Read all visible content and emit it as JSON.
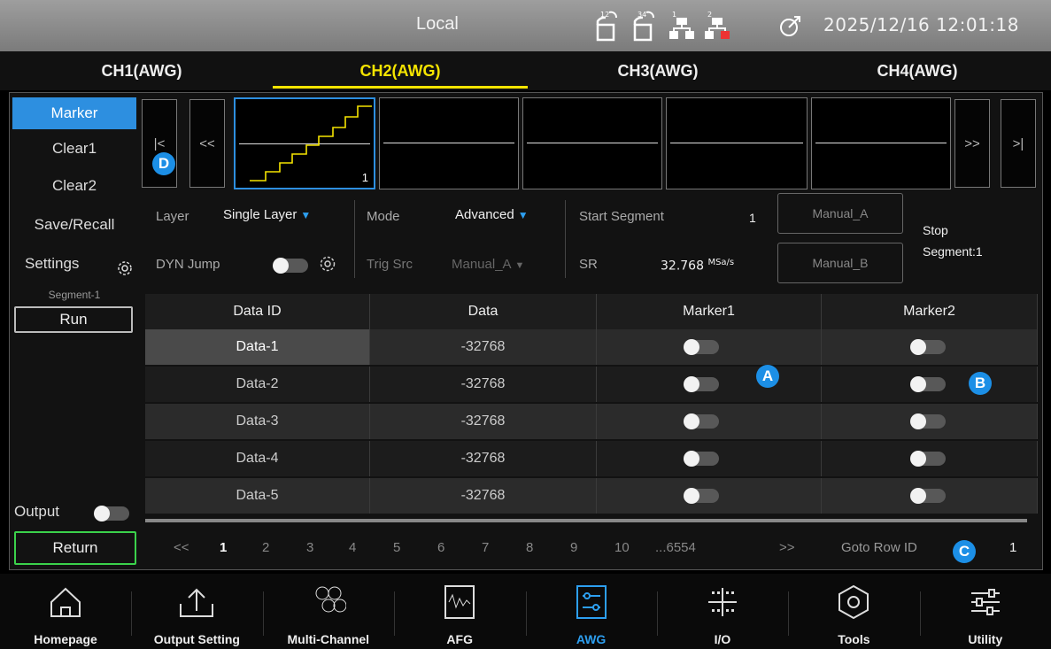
{
  "status": {
    "title": "Local",
    "datetime": "2025/12/16 12:01:18",
    "icons": [
      "usb-12-icon",
      "usb-34-icon",
      "network-1-icon",
      "network-2-disconnected-icon",
      "gps-icon"
    ],
    "icon_labels": [
      "12",
      "34",
      "1",
      "2"
    ]
  },
  "tabs": [
    "CH1(AWG)",
    "CH2(AWG)",
    "CH3(AWG)",
    "CH4(AWG)"
  ],
  "active_tab": "CH2(AWG)",
  "menu": {
    "marker": "Marker",
    "clear1": "Clear1",
    "clear2": "Clear2",
    "save_recall": "Save/Recall",
    "settings": "Settings",
    "segment": "Segment-1",
    "run": "Run",
    "output": "Output",
    "return": "Return"
  },
  "nav": {
    "first": "|<",
    "prev": "<<",
    "next": ">>",
    "last": ">|"
  },
  "thumb_index": "1",
  "controls": {
    "layer_label": "Layer",
    "layer_value": "Single Layer",
    "mode_label": "Mode",
    "mode_value": "Advanced",
    "start_segment_label": "Start Segment",
    "start_segment_value": "1",
    "manual_a": "Manual_A",
    "manual_b": "Manual_B",
    "stop_segment_line1": "Stop",
    "stop_segment_line2": "Segment:1",
    "dyn_jump_label": "DYN Jump",
    "trig_src_label": "Trig Src",
    "trig_src_value": "Manual_A",
    "sr_label": "SR",
    "sr_value": "32.768",
    "sr_unit": "MSa/s"
  },
  "table": {
    "headers": [
      "Data ID",
      "Data",
      "Marker1",
      "Marker2"
    ],
    "rows": [
      {
        "id": "Data-1",
        "data": "-32768",
        "m1": false,
        "m2": false
      },
      {
        "id": "Data-2",
        "data": "-32768",
        "m1": false,
        "m2": false
      },
      {
        "id": "Data-3",
        "data": "-32768",
        "m1": false,
        "m2": false
      },
      {
        "id": "Data-4",
        "data": "-32768",
        "m1": false,
        "m2": false
      },
      {
        "id": "Data-5",
        "data": "-32768",
        "m1": false,
        "m2": false
      }
    ]
  },
  "callouts": {
    "a": "A",
    "b": "B",
    "c": "C",
    "d": "D"
  },
  "pager": {
    "prev": "<<",
    "pages": [
      "1",
      "2",
      "3",
      "4",
      "5",
      "6",
      "7",
      "8",
      "9",
      "10",
      "...6554"
    ],
    "next": ">>",
    "goto_label": "Goto Row ID",
    "goto_value": "1"
  },
  "dock": [
    {
      "label": "Homepage",
      "icon": "home-icon"
    },
    {
      "label": "Output Setting",
      "icon": "output-setting-icon"
    },
    {
      "label": "Multi-Channel",
      "icon": "multi-channel-icon"
    },
    {
      "label": "AFG",
      "icon": "afg-icon"
    },
    {
      "label": "AWG",
      "icon": "awg-icon"
    },
    {
      "label": "I/O",
      "icon": "io-icon"
    },
    {
      "label": "Tools",
      "icon": "tools-icon"
    },
    {
      "label": "Utility",
      "icon": "utility-icon"
    }
  ],
  "dock_active": "AWG",
  "colors": {
    "accent": "#2d8fe0",
    "active_tab": "#f5e400",
    "waveform": "#f5e400"
  }
}
